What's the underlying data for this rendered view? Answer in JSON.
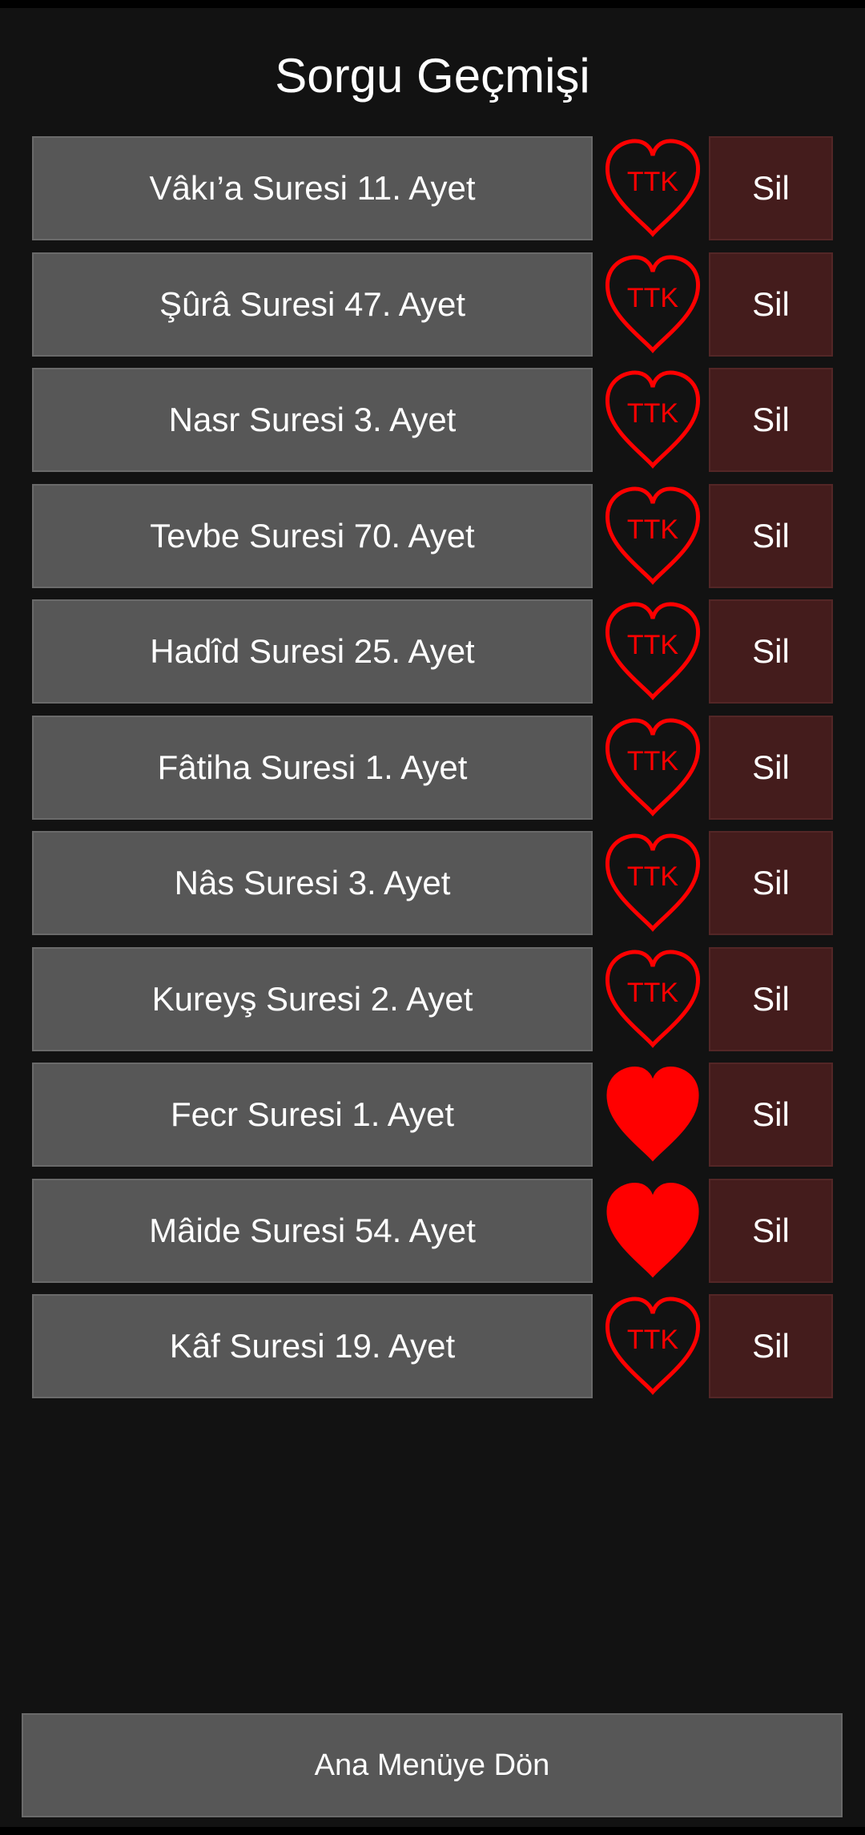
{
  "page": {
    "title": "Sorgu Geçmişi"
  },
  "colors": {
    "background": "#121212",
    "query_button": "#575757",
    "delete_button": "#441c1c",
    "heart": "#ff0000",
    "text": "#ffffff"
  },
  "history": [
    {
      "label": "Vâkı’a Suresi 11. Ayet",
      "favorite": false,
      "delete_label": "Sil",
      "heart_text": "TTK"
    },
    {
      "label": "Şûrâ Suresi 47. Ayet",
      "favorite": false,
      "delete_label": "Sil",
      "heart_text": "TTK"
    },
    {
      "label": "Nasr Suresi 3. Ayet",
      "favorite": false,
      "delete_label": "Sil",
      "heart_text": "TTK"
    },
    {
      "label": "Tevbe Suresi 70. Ayet",
      "favorite": false,
      "delete_label": "Sil",
      "heart_text": "TTK"
    },
    {
      "label": "Hadîd Suresi 25. Ayet",
      "favorite": false,
      "delete_label": "Sil",
      "heart_text": "TTK"
    },
    {
      "label": "Fâtiha Suresi 1. Ayet",
      "favorite": false,
      "delete_label": "Sil",
      "heart_text": "TTK"
    },
    {
      "label": "Nâs Suresi 3. Ayet",
      "favorite": false,
      "delete_label": "Sil",
      "heart_text": "TTK"
    },
    {
      "label": "Kureyş Suresi 2. Ayet",
      "favorite": false,
      "delete_label": "Sil",
      "heart_text": "TTK"
    },
    {
      "label": "Fecr Suresi 1. Ayet",
      "favorite": true,
      "delete_label": "Sil",
      "heart_text": ""
    },
    {
      "label": "Mâide Suresi 54. Ayet",
      "favorite": true,
      "delete_label": "Sil",
      "heart_text": ""
    },
    {
      "label": "Kâf Suresi 19. Ayet",
      "favorite": false,
      "delete_label": "Sil",
      "heart_text": "TTK"
    }
  ],
  "footer": {
    "main_menu_label": "Ana Menüye Dön"
  }
}
